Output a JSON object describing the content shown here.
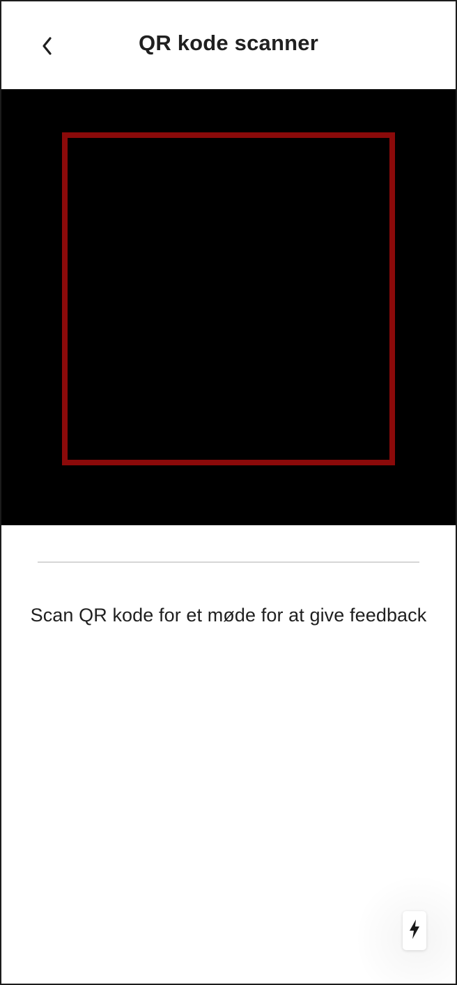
{
  "header": {
    "title": "QR kode scanner",
    "back_icon": "chevron-left-icon"
  },
  "scanner": {
    "frame_color": "#8b0a0a",
    "background_color": "#000000"
  },
  "instructions": {
    "text": "Scan QR kode for et møde for at give feedback"
  },
  "flash": {
    "icon": "flash-icon"
  }
}
